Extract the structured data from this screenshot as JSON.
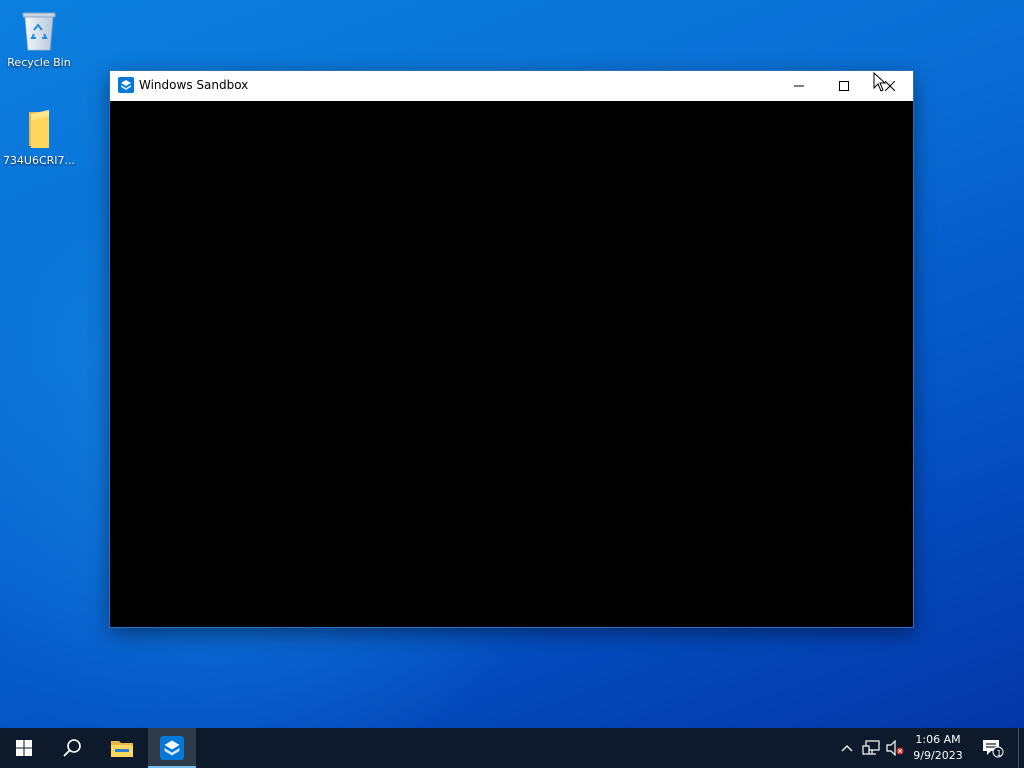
{
  "desktop": {
    "icons": [
      {
        "label": "Recycle Bin",
        "icon": "recycle-bin-icon"
      },
      {
        "label": "734U6CRI7...",
        "icon": "folder-icon"
      }
    ]
  },
  "window": {
    "title": "Windows Sandbox",
    "icon": "windows-sandbox-icon",
    "controls": [
      "minimize",
      "maximize",
      "close"
    ]
  },
  "taskbar": {
    "buttons": [
      {
        "name": "start",
        "icon": "windows-logo-icon"
      },
      {
        "name": "search",
        "icon": "search-icon"
      },
      {
        "name": "file-explorer",
        "icon": "folder-icon"
      },
      {
        "name": "windows-sandbox",
        "icon": "windows-sandbox-icon",
        "active": true
      }
    ],
    "tray": {
      "time": "1:06 AM",
      "date": "9/9/2023",
      "notification_count": "1"
    }
  },
  "colors": {
    "desktop_bg": "#0a6fd6",
    "taskbar_bg": "#0d1a2b",
    "accent": "#0078d7"
  }
}
